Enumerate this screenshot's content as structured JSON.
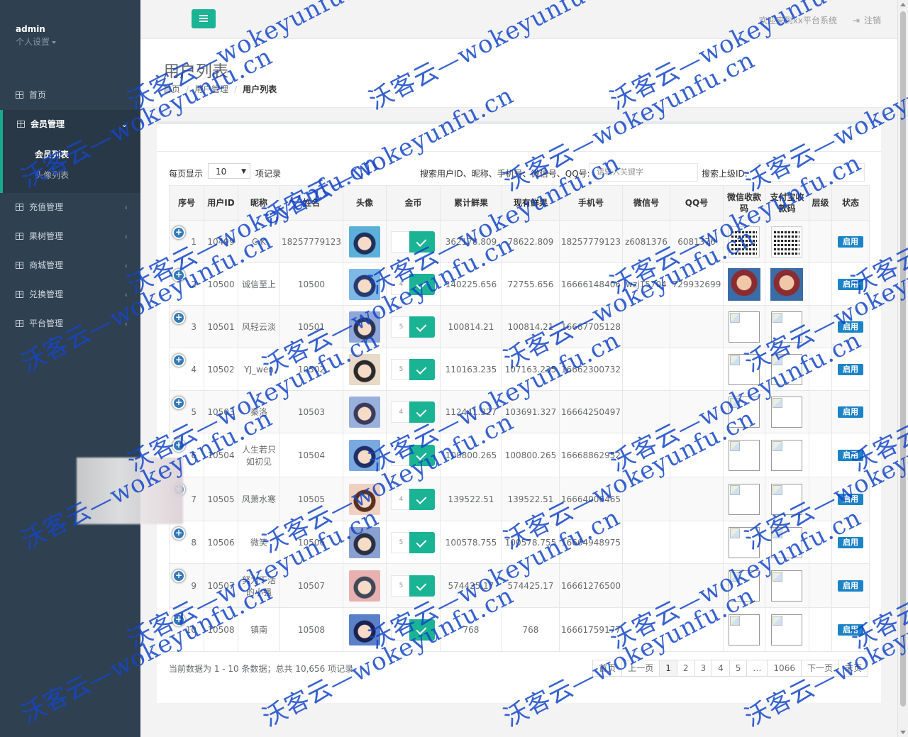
{
  "sidebar": {
    "user": "admin",
    "settings": "个人设置",
    "menu": [
      {
        "label": "首页"
      },
      {
        "label": "会员管理"
      },
      {
        "label": "充值管理"
      },
      {
        "label": "果树管理"
      },
      {
        "label": "商城管理"
      },
      {
        "label": "兑换管理"
      },
      {
        "label": "平台管理"
      }
    ],
    "submenu": [
      {
        "label": "会员列表"
      },
      {
        "label": "头像列表"
      }
    ]
  },
  "topbar": {
    "welcome": "欢迎来到xx平台系统",
    "logout": "注销"
  },
  "heading": {
    "title": "用户列表",
    "breadcrumb": [
      "首页",
      "用户管理",
      "用户列表"
    ]
  },
  "toolbar": {
    "per_page_prefix": "每页显示",
    "per_page_value": "10",
    "per_page_suffix": "项记录",
    "search_label": "搜索用户ID、昵称、手机号、微信号、QQ号:",
    "search_placeholder": "请输入关键字",
    "search_parent_label": "搜索上级ID:"
  },
  "table": {
    "headers": [
      "序号",
      "用户ID",
      "昵称",
      "姓名",
      "头像",
      "金币",
      "累计鲜果",
      "现有鲜果",
      "手机号",
      "微信号",
      "QQ号",
      "微信收款码",
      "支付宝收款码",
      "层级",
      "状态"
    ],
    "rows": [
      {
        "seq": "1",
        "uid": "10499",
        "nick": "C.K",
        "name": "18257779123",
        "coin": "",
        "total": "362178.809",
        "current": "78622.809",
        "phone": "18257779123",
        "wechat": "z6081376",
        "qq": "6081376",
        "status": "启用"
      },
      {
        "seq": "2",
        "uid": "10500",
        "nick": "诚信至上",
        "name": "10500",
        "coin": "4",
        "total": "140225.656",
        "current": "72755.656",
        "phone": "16666148406",
        "wechat": "wzj15704",
        "qq": "729932699",
        "status": "启用"
      },
      {
        "seq": "3",
        "uid": "10501",
        "nick": "风轻云淡",
        "name": "10501",
        "coin": "5",
        "total": "100814.21",
        "current": "100814.21",
        "phone": "16667705128",
        "wechat": "",
        "qq": "",
        "status": "启用"
      },
      {
        "seq": "4",
        "uid": "10502",
        "nick": "YJ_wen",
        "name": "10502",
        "coin": "5",
        "total": "110163.235",
        "current": "107163.235",
        "phone": "16662300732",
        "wechat": "",
        "qq": "",
        "status": "启用"
      },
      {
        "seq": "5",
        "uid": "10503",
        "nick": "秦洛",
        "name": "10503",
        "coin": "4",
        "total": "112441.327",
        "current": "103691.327",
        "phone": "16664250497",
        "wechat": "",
        "qq": "",
        "status": "启用"
      },
      {
        "seq": "6",
        "uid": "10504",
        "nick": "人生若只如初见",
        "name": "10504",
        "coin": "5",
        "total": "100800.265",
        "current": "100800.265",
        "phone": "16668862952",
        "wechat": "",
        "qq": "",
        "status": "启用"
      },
      {
        "seq": "7",
        "uid": "10505",
        "nick": "风萧水寒",
        "name": "10505",
        "coin": "4",
        "total": "139522.51",
        "current": "139522.51",
        "phone": "16664006465",
        "wechat": "",
        "qq": "",
        "status": "启用"
      },
      {
        "seq": "8",
        "uid": "10506",
        "nick": "微笑",
        "name": "10506",
        "coin": "5",
        "total": "100578.755",
        "current": "100578.755",
        "phone": "16664948975",
        "wechat": "",
        "qq": "",
        "status": "启用"
      },
      {
        "seq": "9",
        "uid": "10507",
        "nick": "努力干活的小强",
        "name": "10507",
        "coin": "5",
        "total": "574425.17",
        "current": "574425.17",
        "phone": "16661276500",
        "wechat": "",
        "qq": "",
        "status": "启用"
      },
      {
        "seq": "10",
        "uid": "10508",
        "nick": "镇南",
        "name": "10508",
        "coin": "5",
        "total": "768",
        "current": "768",
        "phone": "16661759177",
        "wechat": "",
        "qq": "",
        "status": "启用"
      }
    ]
  },
  "footer": {
    "info": "当前数据为 1 - 10 条数据；总共 10,656 项记录",
    "pages": [
      "首页",
      "上一页",
      "1",
      "2",
      "3",
      "4",
      "5",
      "…",
      "1066",
      "下一页",
      "末页"
    ]
  },
  "watermark": "沃客云—wokeyunfu.cn",
  "colors": {
    "sidebar": "#2f4050",
    "accent": "#1ab394",
    "button_blue": "#1c84c6"
  }
}
